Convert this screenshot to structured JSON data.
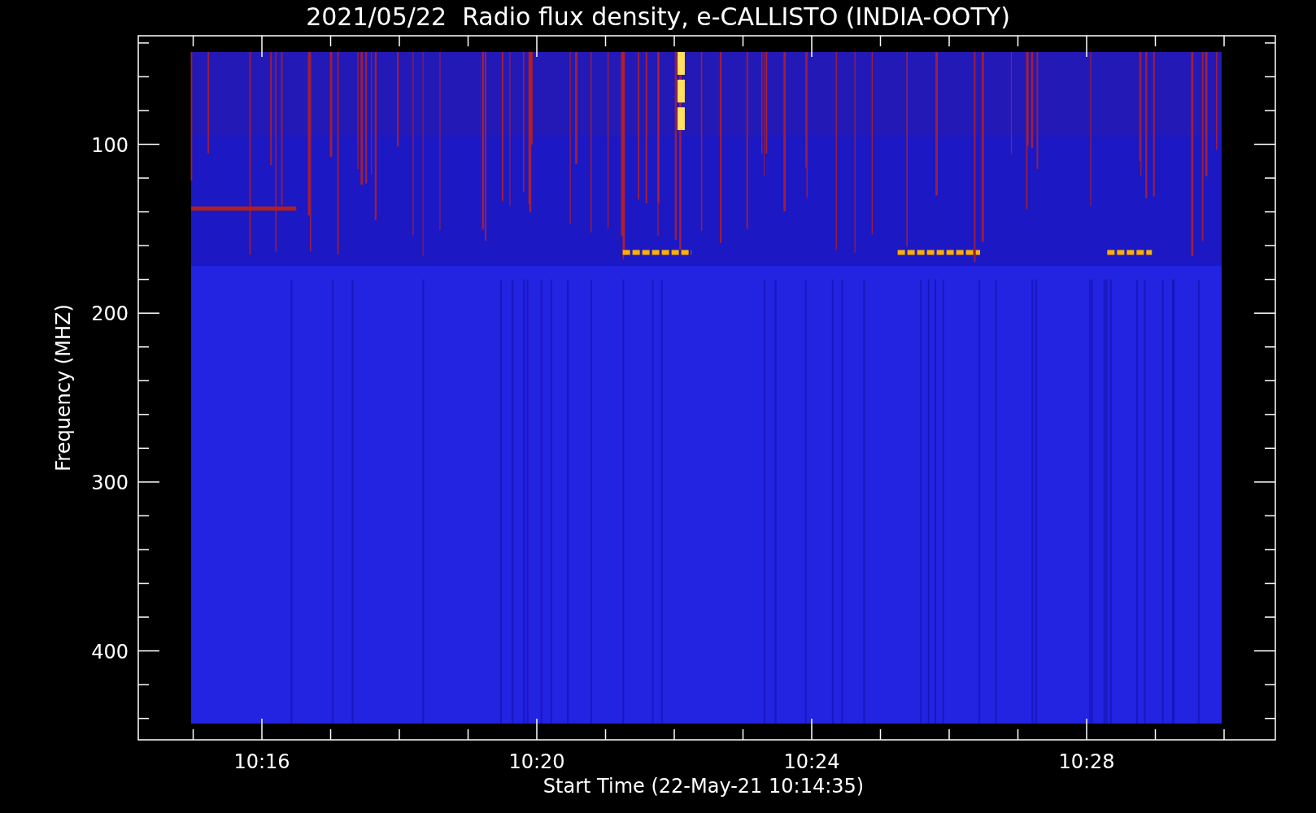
{
  "title": "2021/05/22  Radio flux density, e-CALLISTO (INDIA-OOTY)",
  "y_axis": {
    "label": "Frequency (MHZ)",
    "tick_labels": [
      "100",
      "200",
      "300",
      "400"
    ]
  },
  "x_axis": {
    "label": "Start Time (22-May-21 10:14:35)",
    "tick_labels": [
      "10:16",
      "10:20",
      "10:24",
      "10:28"
    ]
  }
}
